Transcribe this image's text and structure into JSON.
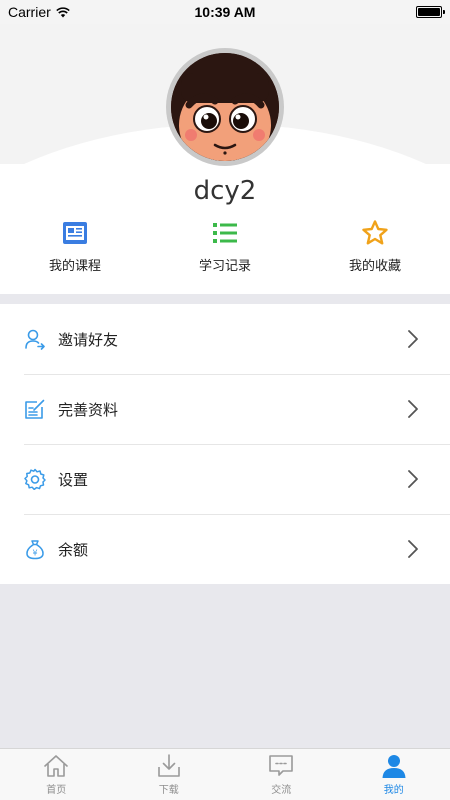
{
  "status_bar": {
    "carrier": "Carrier",
    "time": "10:39 AM"
  },
  "profile": {
    "username": "dcy2"
  },
  "quick_actions": [
    {
      "label": "我的课程",
      "icon": "course-icon",
      "color": "#3a7de1"
    },
    {
      "label": "学习记录",
      "icon": "list-icon",
      "color": "#3cb94a"
    },
    {
      "label": "我的收藏",
      "icon": "star-icon",
      "color": "#f0a21a"
    }
  ],
  "menu": [
    {
      "label": "邀请好友",
      "icon": "invite-user-icon"
    },
    {
      "label": "完善资料",
      "icon": "edit-profile-icon"
    },
    {
      "label": "设置",
      "icon": "gear-icon"
    },
    {
      "label": "余额",
      "icon": "money-bag-icon"
    }
  ],
  "tabs": [
    {
      "label": "首页",
      "icon": "home-icon",
      "active": false
    },
    {
      "label": "下载",
      "icon": "download-icon",
      "active": false
    },
    {
      "label": "交流",
      "icon": "chat-icon",
      "active": false
    },
    {
      "label": "我的",
      "icon": "person-icon",
      "active": true
    }
  ],
  "colors": {
    "accent": "#1e88e5",
    "menu_icon": "#3a9be8",
    "background": "#e8e8ed"
  }
}
